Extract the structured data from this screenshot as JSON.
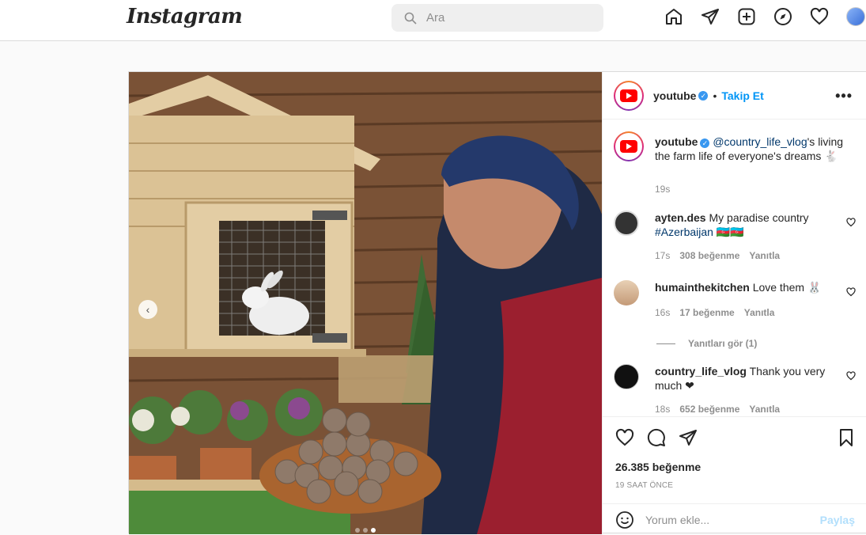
{
  "nav": {
    "logo": "Instagram",
    "search_placeholder": "Ara",
    "icons": [
      "home-icon",
      "direct-icon",
      "new-post-icon",
      "explore-icon",
      "activity-icon",
      "profile-avatar"
    ]
  },
  "post": {
    "header": {
      "username": "youtube",
      "separator": "•",
      "follow_label": "Takip Et",
      "more_label": "•••"
    },
    "caption": {
      "username": "youtube",
      "mention": "@country_life_vlog",
      "text": "'s living the farm life of everyone's dreams",
      "emoji": "🐇",
      "time": "19s"
    },
    "comments": [
      {
        "username": "ayten.des",
        "text": "My paradise country ",
        "hashtag": "#Azerbaijan",
        "emoji": "🇦🇿🇦🇿",
        "time": "17s",
        "likes": "308 beğenme",
        "reply": "Yanıtla"
      },
      {
        "username": "humainthekitchen",
        "text": "Love them",
        "emoji": "🐰",
        "time": "16s",
        "likes": "17 beğenme",
        "reply": "Yanıtla"
      },
      {
        "username": "country_life_vlog",
        "text": "Thank you very much",
        "emoji": "❤",
        "time": "18s",
        "likes": "652 beğenme",
        "reply": "Yanıtla"
      }
    ],
    "view_replies": "Yanıtları gör (1)",
    "likes_count": "26.385 beğenme",
    "timestamp": "19 SAAT ÖNCE",
    "comment_placeholder": "Yorum ekle...",
    "share_label": "Paylaş"
  },
  "colors": {
    "accent": "#0095f6",
    "verified": "#3897f0",
    "youtube_red": "#ff0000"
  }
}
